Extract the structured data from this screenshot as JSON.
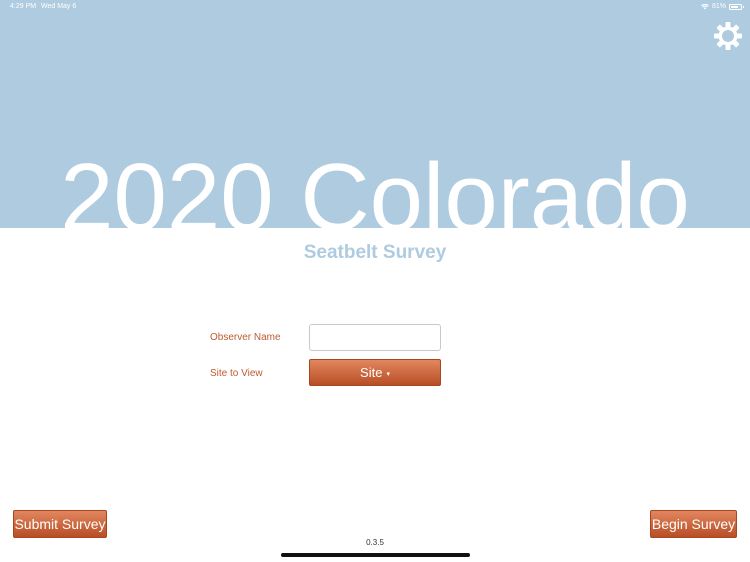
{
  "status_bar": {
    "time": "4:29 PM",
    "date": "Wed May 6",
    "battery": "81%"
  },
  "header": {
    "title": "2020 Colorado",
    "subtitle": "Seatbelt Survey",
    "settings_icon": "gear-icon"
  },
  "form": {
    "observer_label": "Observer Name",
    "observer_value": "",
    "site_label": "Site to View",
    "site_button_label": "Site",
    "site_caret": "▾"
  },
  "footer": {
    "submit_label": "Submit Survey",
    "begin_label": "Begin Survey",
    "version": "0.3.5"
  },
  "colors": {
    "hero_background": "#aecbe0",
    "accent_orange": "#c9643a",
    "label_text": "#bf5a30"
  }
}
